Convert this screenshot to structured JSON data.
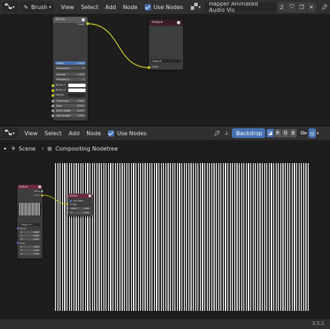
{
  "top_header": {
    "editor_icon": "node-editor-icon",
    "mode": "Brush",
    "menus": [
      "View",
      "Select",
      "Add",
      "Node"
    ],
    "use_nodes_label": "Use Nodes",
    "tree_name": "Happer Animated Audio Vis",
    "user_count": "2"
  },
  "bricks_node": {
    "title": "Bricks",
    "output_label": "Color",
    "fields": [
      {
        "label": "Offset",
        "value": "0.500"
      },
      {
        "label": "Frequency",
        "value": "2"
      },
      {
        "label": "Squash",
        "value": "1.000"
      },
      {
        "label": "Frequency",
        "value": "2"
      }
    ],
    "inputs": [
      {
        "label": "Bricks 1"
      },
      {
        "label": "Bricks 2"
      },
      {
        "label": "Mortar"
      },
      {
        "label": "Thickness",
        "value": "0.005"
      },
      {
        "label": "Bias",
        "value": "0.000"
      },
      {
        "label": "Brick Width",
        "value": "0.017"
      },
      {
        "label": "Row Height",
        "value": "2.000"
      }
    ]
  },
  "output_node": {
    "title": "Output",
    "target": "Default",
    "input_label": "Color"
  },
  "bot_header": {
    "menus": [
      "View",
      "Select",
      "Add",
      "Node"
    ],
    "use_nodes_label": "Use Nodes",
    "backdrop_label": "Backdrop",
    "channels": [
      "",
      "R",
      "G",
      "B"
    ]
  },
  "breadcrumb": {
    "scene": "Scene",
    "tree": "Compositing Nodetree"
  },
  "texture_node": {
    "title": "Texture",
    "out1": "Value",
    "out2": "Color",
    "image_name": "Happer Ar...",
    "offset_label": "Offset",
    "scale_label": "Scale",
    "offset_values": [
      "0.000",
      "0.000",
      "0.000"
    ],
    "scale_values": [
      "1.000",
      "1.000",
      "1.000"
    ]
  },
  "viewer_node": {
    "title": "Viewer",
    "use_alpha": "Use Alpha",
    "image_label": "Image",
    "alpha_label": "Alpha",
    "alpha_value": "1.000",
    "z_label": "Z",
    "z_value": "1.000"
  },
  "version": "3.5.1",
  "colors": {
    "accent": "#4772b3",
    "output_header": "#3b1c28",
    "texture_header": "#6b2940",
    "link": "#c7c729"
  }
}
